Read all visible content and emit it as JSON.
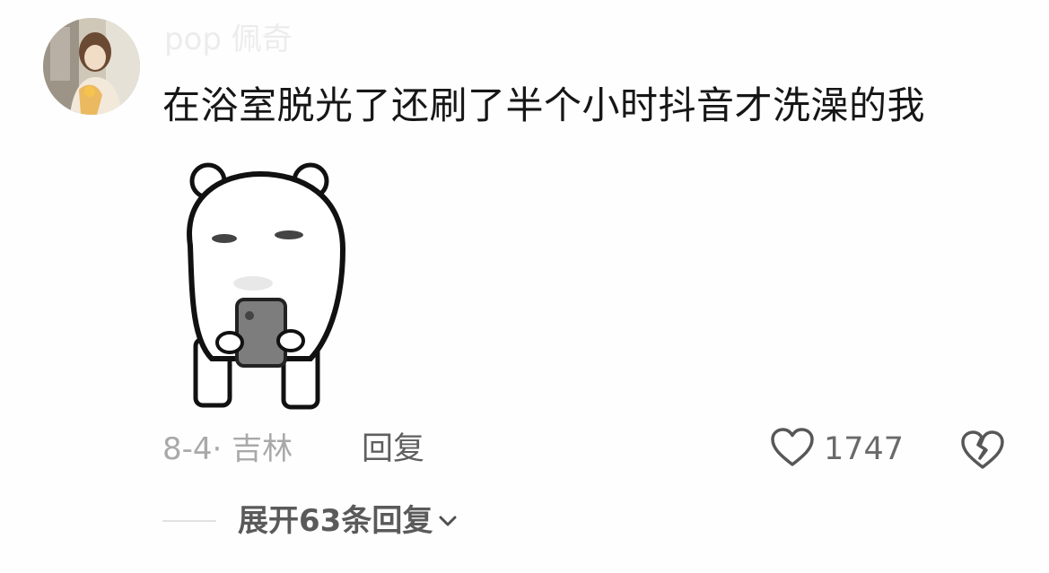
{
  "comment": {
    "username": "pop 佩奇",
    "text": "在浴室脱光了还刷了半个小时抖音才洗澡的我",
    "sticker": "bear-using-phone-sticker",
    "time_location": "8-4· 吉林",
    "reply_label": "回复",
    "like_count": "1747",
    "like_icon": "heart-outline-icon",
    "dislike_icon": "broken-heart-icon",
    "expand_label": "展开63条回复",
    "expand_icon": "chevron-down-icon"
  },
  "colors": {
    "background": "#fefefe",
    "text_primary": "#161616",
    "text_secondary": "#a9a9a9",
    "username_faded": "#ececec"
  }
}
